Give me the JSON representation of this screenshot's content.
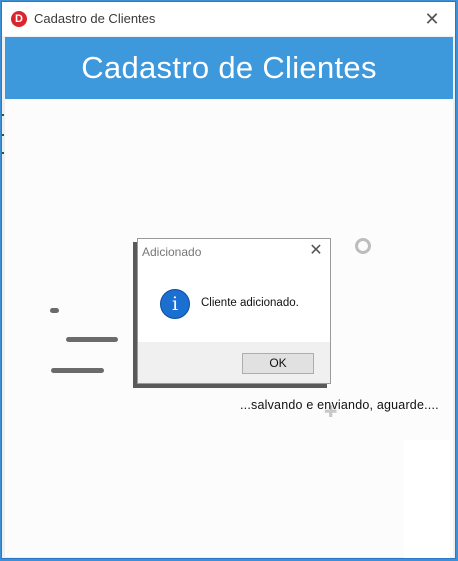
{
  "window": {
    "title": "Cadastro de Clientes",
    "app_icon": "D",
    "close_symbol": "✕"
  },
  "header": {
    "title": "Cadastro de Clientes"
  },
  "loading": {
    "status_text": "...salvando e enviando, aguarde...."
  },
  "dialog": {
    "title": "Adicionado",
    "close_symbol": "✕",
    "icon_glyph": "i",
    "message": "Cliente adicionado.",
    "ok_label": "OK"
  },
  "colors": {
    "header_bg": "#3d98dc",
    "app_icon": "#d9262e",
    "info_icon": "#1a6fd1"
  }
}
